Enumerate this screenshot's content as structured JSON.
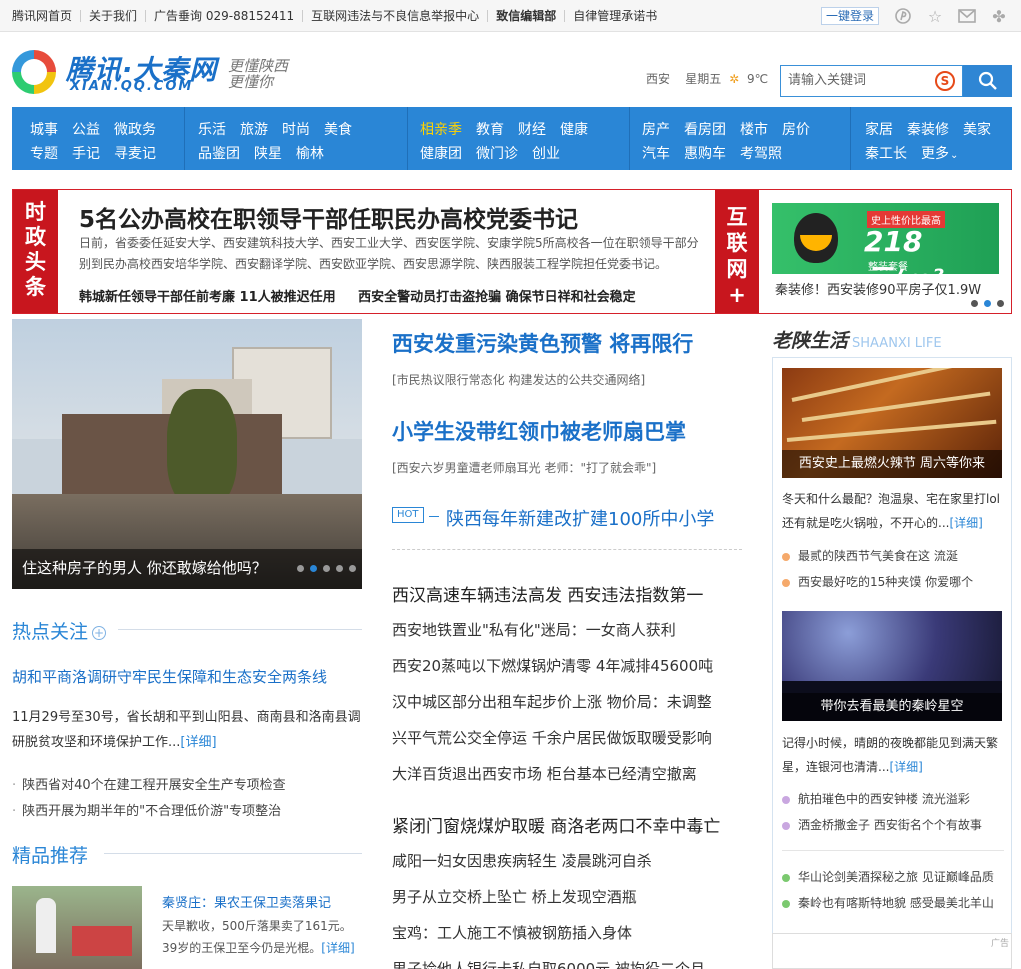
{
  "topbar": {
    "links": [
      "腾讯网首页",
      "关于我们",
      "广告垂询 029-88152411",
      "互联网违法与不良信息举报中心",
      "致信编辑部",
      "自律管理承诺书"
    ],
    "login": "一键登录"
  },
  "header": {
    "logo_name": "腾讯·大秦网",
    "logo_domain": "XIAN.QQ.COM",
    "slogan1": "更懂陕西",
    "slogan2": "更懂你",
    "city": "西安",
    "weekday": "星期五",
    "temp": "9℃",
    "search_placeholder": "请输入关键词"
  },
  "nav": {
    "groups": [
      {
        "row1": [
          "城事",
          "公益",
          "微政务"
        ],
        "row2": [
          "专题",
          "手记",
          "寻麦记"
        ]
      },
      {
        "row1": [
          "乐活",
          "旅游",
          "时尚",
          "美食"
        ],
        "row2": [
          "品鉴团",
          "陕星",
          "榆林"
        ]
      },
      {
        "row1": [
          "相亲季",
          "教育",
          "财经",
          "健康"
        ],
        "row2": [
          "健康团",
          "微门诊",
          "创业"
        ]
      },
      {
        "row1": [
          "房产",
          "看房团",
          "楼市",
          "房价"
        ],
        "row2": [
          "汽车",
          "惠购车",
          "考驾照"
        ]
      },
      {
        "row1": [
          "家居",
          "秦装修",
          "美家"
        ],
        "row2": [
          "秦工长",
          "更多"
        ]
      }
    ]
  },
  "headline": {
    "label": [
      "时",
      "政",
      "头",
      "条"
    ],
    "title": "5名公办高校在职领导干部任职民办高校党委书记",
    "desc": "日前，省委委任延安大学、西安建筑科技大学、西安工业大学、西安医学院、安康学院5所高校各一位在职领导干部分别到民办高校西安培华学院、西安翻译学院、西安欧亚学院、西安思源学院、陕西服装工程学院担任党委书记。",
    "links": [
      "韩城新任领导干部任前考廉 11人被推迟任用",
      "西安全警动员打击盗抢骗 确保节日祥和社会稳定"
    ],
    "label2": [
      "互",
      "联",
      "网",
      "+"
    ],
    "ad_tag": "史上性价比最高",
    "ad_price": "218元/m²",
    "ad_sub": "整装套餐",
    "ad_caption": "秦装修！西安装修90平房子仅1.9W"
  },
  "slider": {
    "caption": "住这种房子的男人 你还敢嫁给他吗？"
  },
  "hot_focus": {
    "title": "热点关注",
    "lead": "胡和平商洛调研守牢民生保障和生态安全两条线",
    "desc": "11月29号至30号，省长胡和平到山阳县、商南县和洛南县调研脱贫攻坚和环境保护工作...",
    "more": "[详细]",
    "bullets": [
      "陕西省对40个在建工程开展安全生产专项检查",
      "陕西开展为期半年的\"不合理低价游\"专项整治"
    ]
  },
  "recommend": {
    "title": "精品推荐",
    "item_title": "秦贤庄：果农王保卫卖落果记",
    "item_desc": "天旱歉收，500斤落果卖了161元。39岁的王保卫至今仍是光棍。",
    "more": "[详细]"
  },
  "middle": {
    "h1": "西安发重污染黄色预警 将再限行",
    "sub1": "[市民热议限行常态化 构建发达的公共交通网络]",
    "h2": "小学生没带红领巾被老师扇巴掌",
    "sub2": "[西安六岁男童遭老师扇耳光 老师：\"打了就会乖\"]",
    "hot": "HOT",
    "hot_title": "陕西每年新建改扩建100所中小学",
    "lead1": "西汉高速车辆违法高发 西安违法指数第一",
    "group1": [
      "西安地铁置业\"私有化\"迷局：一女商人获利",
      "西安20蒸吨以下燃煤锅炉清零 4年减排45600吨",
      "汉中城区部分出租车起步价上涨 物价局：未调整",
      "兴平气荒公交全停运 千余户居民做饭取暖受影响",
      "大洋百货退出西安市场 柜台基本已经清空撤离"
    ],
    "lead2": "紧闭门窗烧煤炉取暖 商洛老两口不幸中毒亡",
    "group2": [
      "咸阳一妇女因患疾病轻生 凌晨跳河自杀",
      "男子从立交桥上坠亡 桥上发现空酒瓶",
      "宝鸡：工人施工不慎被钢筋插入身体",
      "男子捡他人银行卡私自取6000元 被拘役二个月"
    ]
  },
  "life": {
    "title": "老陕生活",
    "title_en": "SHAANXI LIFE",
    "cap1": "西安史上最燃火辣节 周六等你来",
    "desc1": "冬天和什么最配？泡温泉、宅在家里打lol还有就是吃火锅啦，不开心的...",
    "more": "[详细]",
    "bul1": [
      "最贰的陕西节气美食在这 流涎",
      "西安最好吃的15种夹馍 你爱哪个"
    ],
    "cap2": "带你去看最美的秦岭星空",
    "desc2": "记得小时候，晴朗的夜晚都能见到满天繁星，连银河也清清...",
    "bul2": [
      "航拍璀色中的西安钟楼 流光溢彩",
      "洒金桥撒金子 西安街名个个有故事"
    ],
    "bul3": [
      "华山论剑美酒探秘之旅 见证巅峰品质",
      "秦岭也有喀斯特地貌 感受最美北羊山"
    ],
    "ad_label": "广告",
    "colors": {
      "orange": "#f5a96b",
      "purple": "#c9a7e0",
      "green": "#7bc96f"
    }
  }
}
